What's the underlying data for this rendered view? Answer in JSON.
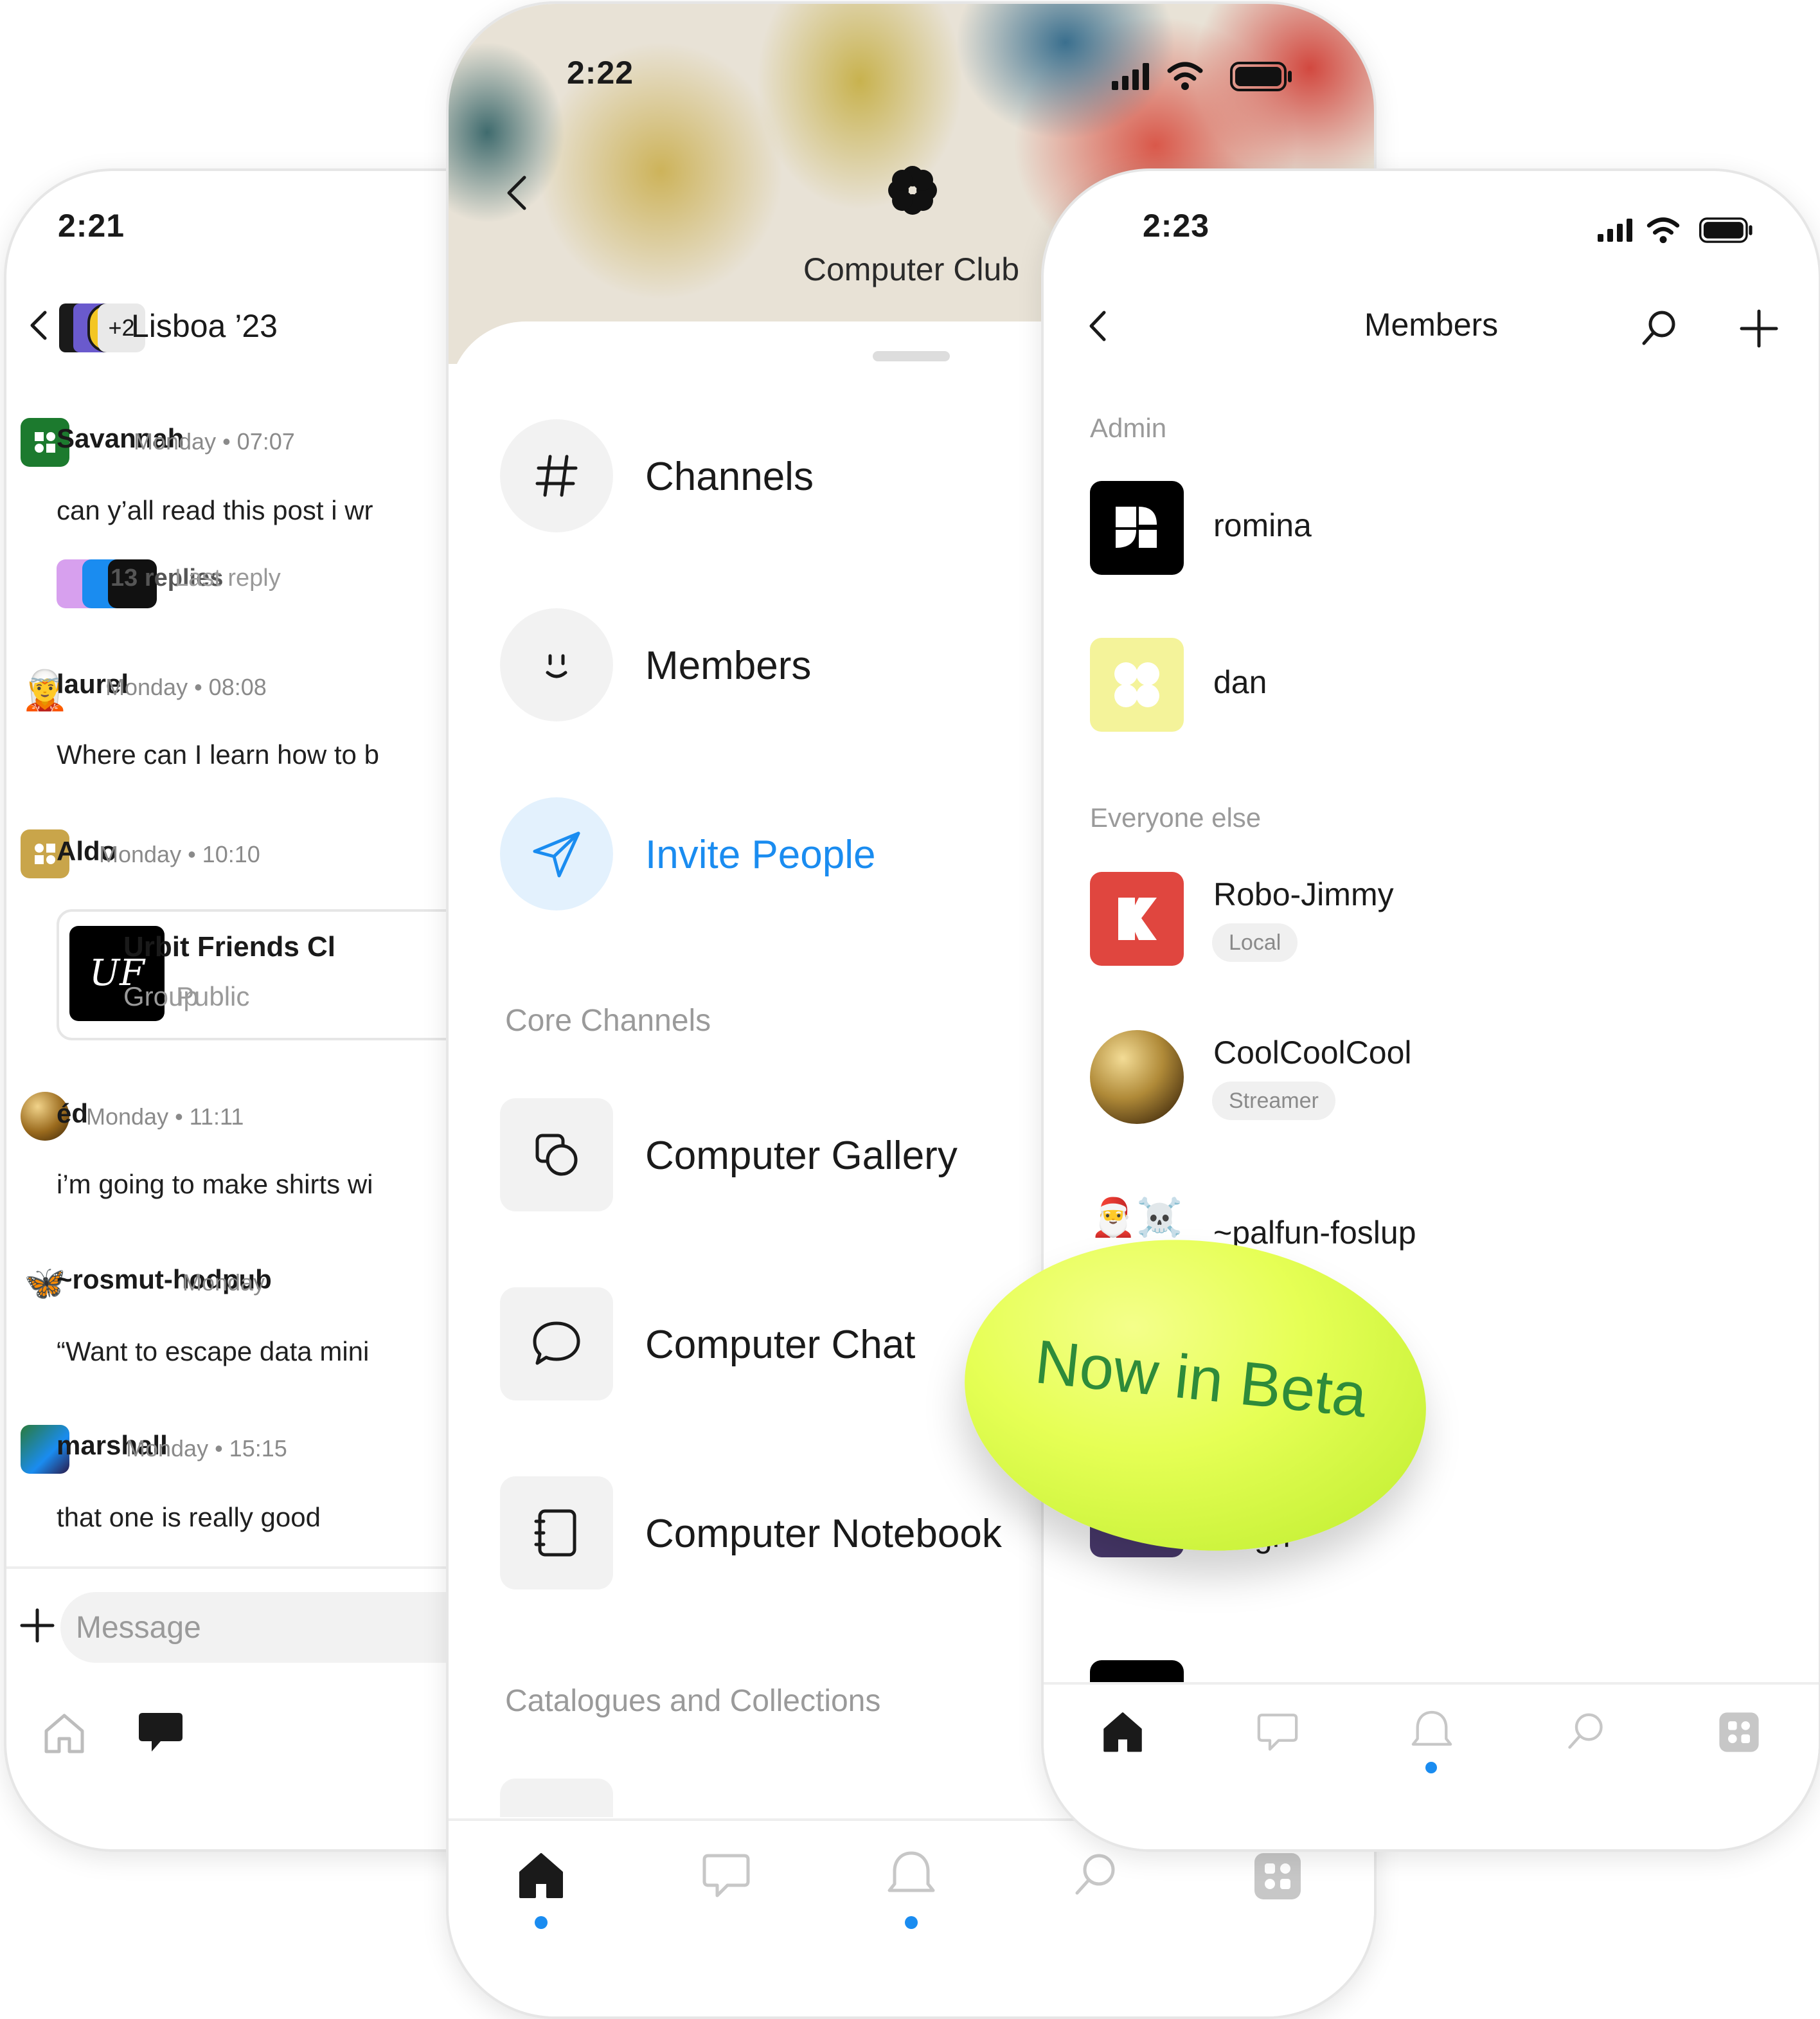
{
  "left": {
    "time": "2:21",
    "chat_title": "Lisboa ’23",
    "extra_members": "+2",
    "messages": [
      {
        "name": "Savannah",
        "time": "Monday • 07:07",
        "text": "can y’all read this post i wr",
        "replies": "13 replies",
        "last_reply": "Last reply"
      },
      {
        "name": "laurel",
        "time": "Monday • 08:08",
        "text": "Where can I learn how to b"
      },
      {
        "name": "Aldo",
        "time": "Monday • 10:10",
        "card_title": "Urbit Friends Cl",
        "card_kind": "Group",
        "card_visibility": "Public",
        "card_logo": "UF"
      },
      {
        "name": "éd",
        "time": "Monday • 11:11",
        "text": "i’m going to make shirts wi"
      },
      {
        "name": "~rosmut-hodpub",
        "time": "Monday",
        "text": "“Want to escape data mini"
      },
      {
        "name": "marshall",
        "time": "Monday • 15:15",
        "text": "that one is really good"
      }
    ],
    "message_placeholder": "Message"
  },
  "center": {
    "time": "2:22",
    "group_name": "Computer Club",
    "menu": [
      {
        "label": "Channels",
        "icon": "hash-icon"
      },
      {
        "label": "Members",
        "icon": "smile-icon"
      },
      {
        "label": "Invite People",
        "icon": "send-icon"
      }
    ],
    "core_channels_header": "Core Channels",
    "channels": [
      {
        "label": "Computer Gallery",
        "icon": "gallery-icon"
      },
      {
        "label": "Computer Chat",
        "icon": "chat-bubble-icon"
      },
      {
        "label": "Computer Notebook",
        "icon": "notebook-icon"
      }
    ],
    "catalogues_header": "Catalogues and Collections"
  },
  "right": {
    "time": "2:23",
    "title": "Members",
    "admin_header": "Admin",
    "admins": [
      {
        "name": "romina",
        "bg": "#000000"
      },
      {
        "name": "dan",
        "bg": "#f4f39a"
      }
    ],
    "everyone_header": "Everyone else",
    "members": [
      {
        "name": "Robo-Jimmy",
        "tag": "Local",
        "bg": "#e0463f"
      },
      {
        "name": "CoolCoolCool",
        "tag": "Streamer",
        "bg": "#8a6a2a"
      },
      {
        "name": "~palfun-foslup",
        "tag": ""
      },
      {
        "name": "Hugh",
        "tag": "",
        "bg": "#4a3a6e"
      }
    ]
  },
  "badge": {
    "text": "Now in Beta"
  },
  "colors": {
    "accent": "#1a8cf0",
    "beta_blob": "#e6ff55",
    "beta_text": "#2e8b3a"
  }
}
